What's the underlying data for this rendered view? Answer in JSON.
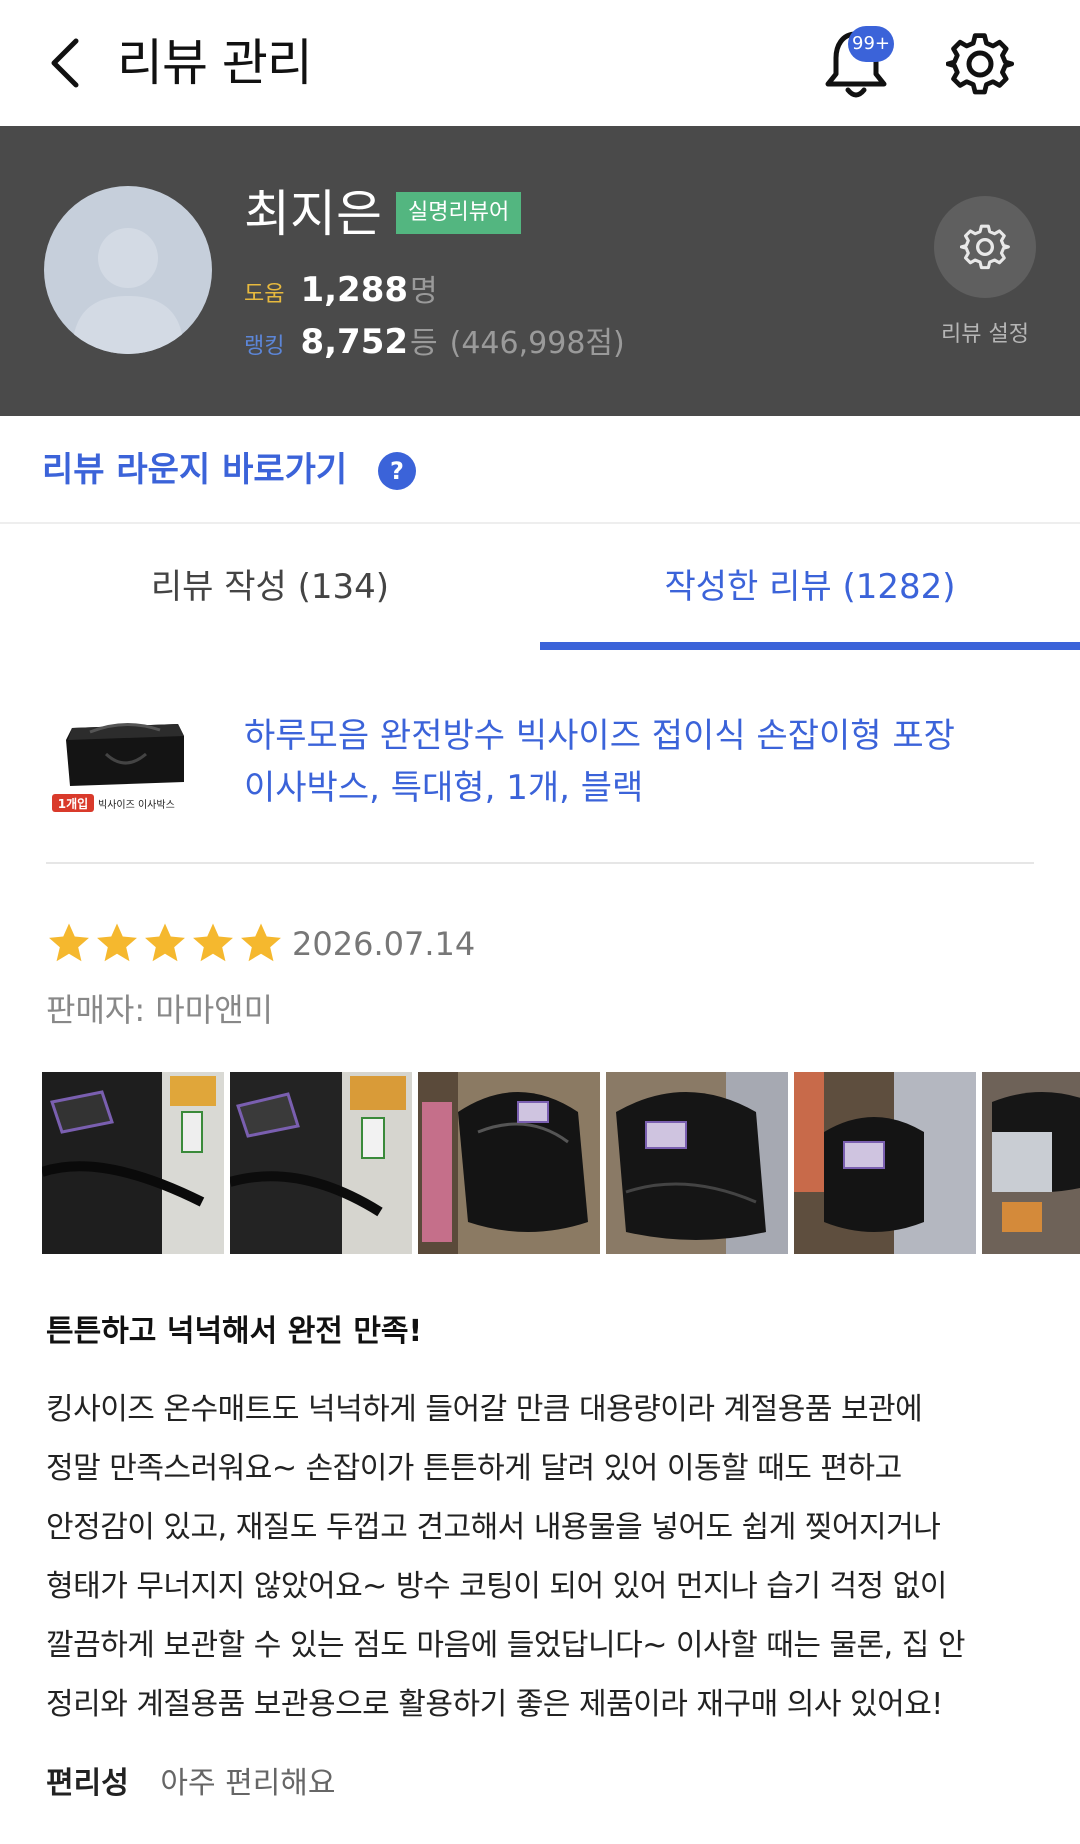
{
  "header": {
    "title": "리뷰 관리",
    "notification_badge": "99+"
  },
  "profile": {
    "name": "최지은",
    "badge": "실명리뷰어",
    "help_label": "도움",
    "help_value": "1,288",
    "help_unit": "명",
    "rank_label": "랭킹",
    "rank_value": "8,752",
    "rank_unit": "등",
    "rank_score": "(446,998점)",
    "settings_label": "리뷰 설정"
  },
  "lounge": {
    "link_label": "리뷰 라운지 바로가기",
    "help_icon": "?"
  },
  "tabs": {
    "write": "리뷰 작성 (134)",
    "written": "작성한 리뷰 (1282)"
  },
  "product": {
    "name_line1": "하루모음 완전방수 빅사이즈 접이식 손잡이형 포장",
    "name_line2": "이사박스, 특대형, 1개, 블랙",
    "thumb_tag": "1개입",
    "thumb_caption": "빅사이즈 이사박스"
  },
  "review": {
    "rating": 5,
    "date": "2026.07.14",
    "seller": "판매자: 마마앤미",
    "title": "튼튼하고 넉넉해서 완전 만족!",
    "body_lines": [
      "킹사이즈 온수매트도 넉넉하게 들어갈 만큼 대용량이라 계절용품 보관에",
      "정말 만족스러워요~ 손잡이가 튼튼하게 달려 있어 이동할 때도 편하고",
      "안정감이 있고, 재질도 두껍고 견고해서 내용물을 넣어도 쉽게 찢어지거나",
      "형태가 무너지지 않았어요~ 방수 코팅이 되어 있어 먼지나 습기 걱정 없이",
      "깔끔하게 보관할 수 있는 점도 마음에 들었답니다~ 이사할 때는 물론, 집 안",
      "정리와 계절용품 보관용으로 활용하기 좋은 제품이라 재구매 의사 있어요!"
    ],
    "attribute_label": "편리성",
    "attribute_value": "아주 편리해요"
  },
  "colors": {
    "accent": "#3b63d9",
    "profile_bg": "#4a4a4a",
    "verified_green": "#53b680",
    "star": "#f5b82e"
  }
}
